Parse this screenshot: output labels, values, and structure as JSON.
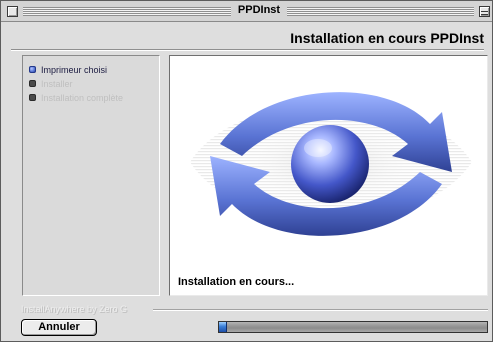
{
  "window": {
    "title": "PPDInst"
  },
  "header": {
    "title": "Installation en cours PPDInst"
  },
  "steps": [
    {
      "label": "Imprimeur choisi",
      "state": "active"
    },
    {
      "label": "Installer",
      "state": "inactive"
    },
    {
      "label": "Installation complète",
      "state": "inactive"
    }
  ],
  "main": {
    "status_text": "Installation en cours..."
  },
  "footer": {
    "vendor_text": "InstallAnywhere by Zero G",
    "cancel_label": "Annuler",
    "progress_fraction": 0.03
  },
  "colors": {
    "active_bullet": "#5f7dd9",
    "inactive_text": "#bfbfbf",
    "window_bg": "#dedede",
    "progress_fill": "#3a7fd8"
  }
}
